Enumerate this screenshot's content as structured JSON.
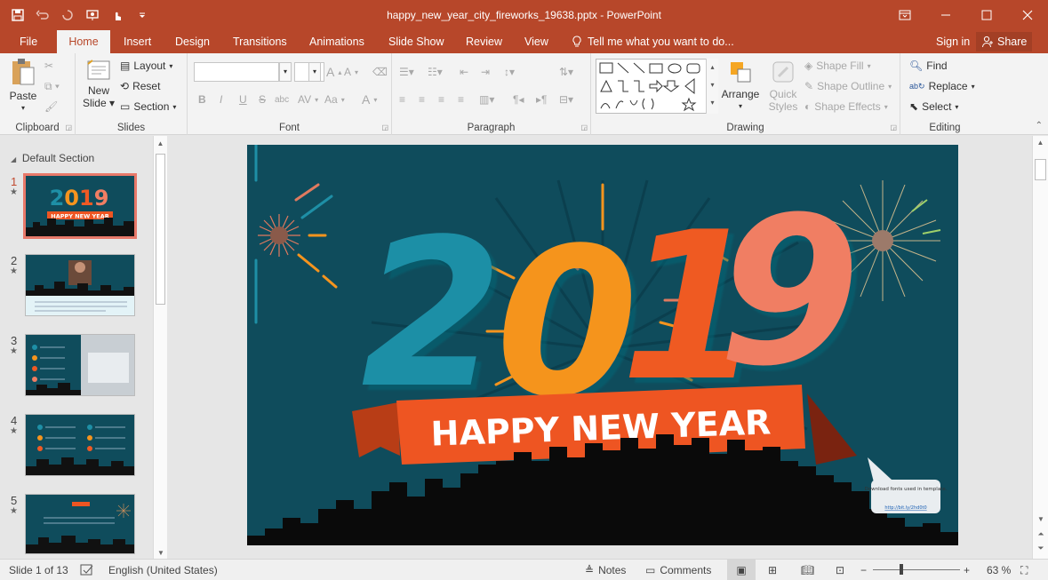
{
  "window": {
    "title": "happy_new_year_city_fireworks_19638.pptx - PowerPoint",
    "accent": "#b7472a"
  },
  "qat": {
    "icons": [
      "save-icon",
      "undo-icon",
      "redo-icon",
      "present-icon",
      "touch-mode-icon",
      "customize-icon"
    ]
  },
  "tabs": [
    "File",
    "Home",
    "Insert",
    "Design",
    "Transitions",
    "Animations",
    "Slide Show",
    "Review",
    "View"
  ],
  "active_tab": "Home",
  "tell_me": "Tell me what you want to do...",
  "sign_in": "Sign in",
  "share": "Share",
  "ribbon": {
    "clipboard": {
      "label": "Clipboard",
      "paste": "Paste"
    },
    "slides": {
      "label": "Slides",
      "new_slide": "New",
      "new_slide2": "Slide",
      "layout": "Layout",
      "reset": "Reset",
      "section": "Section"
    },
    "font": {
      "label": "Font",
      "bold": "B",
      "italic": "I",
      "underline": "U",
      "strike": "S",
      "shadow": "abc",
      "spacing": "AV",
      "case": "Aa",
      "color": "A"
    },
    "paragraph": {
      "label": "Paragraph"
    },
    "drawing": {
      "label": "Drawing",
      "arrange": "Arrange",
      "quick_styles": "Quick",
      "quick_styles2": "Styles",
      "shape_fill": "Shape Fill",
      "shape_outline": "Shape Outline",
      "shape_effects": "Shape Effects"
    },
    "editing": {
      "label": "Editing",
      "find": "Find",
      "replace": "Replace",
      "select": "Select"
    }
  },
  "slides_panel": {
    "section": "Default Section",
    "thumbs": [
      {
        "num": "1",
        "title": "2019",
        "banner": "HAPPY NEW YEAR"
      },
      {
        "num": "2"
      },
      {
        "num": "3"
      },
      {
        "num": "4"
      },
      {
        "num": "5"
      }
    ]
  },
  "slide": {
    "digits": [
      "2",
      "0",
      "1",
      "9"
    ],
    "digit_colors": [
      "#1e8fa6",
      "#f5941e",
      "#ef5a24",
      "#f07e63"
    ],
    "banner": "HAPPY NEW YEAR",
    "callout_text": "Download fonts used in template.",
    "callout_link": "http://bit.ly/2hd0t0"
  },
  "status": {
    "slide_of": "Slide 1 of 13",
    "language": "English (United States)",
    "notes": "Notes",
    "comments": "Comments",
    "zoom": "63 %"
  }
}
